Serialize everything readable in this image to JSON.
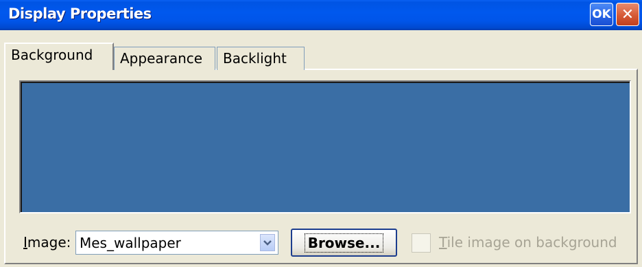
{
  "window": {
    "title": "Display Properties",
    "ok_label": "OK",
    "close_symbol": "✕"
  },
  "tabs": [
    {
      "label": "Background",
      "active": true
    },
    {
      "label": "Appearance",
      "active": false
    },
    {
      "label": "Backlight",
      "active": false
    }
  ],
  "preview": {
    "color": "#3A6EA5"
  },
  "image_field": {
    "label_accel": "I",
    "label_rest": "mage:",
    "value": "Mes_wallpaper",
    "dropdown_icon": "chevron-down-icon"
  },
  "browse_button": {
    "label": "Browse..."
  },
  "tile_option": {
    "label_accel": "T",
    "label_rest": "ile image on background",
    "checked": false,
    "enabled": false
  },
  "colors": {
    "titlebar_blue": "#0058EE",
    "dialog_bg": "#ECE9D8",
    "close_red": "#D65A36"
  }
}
